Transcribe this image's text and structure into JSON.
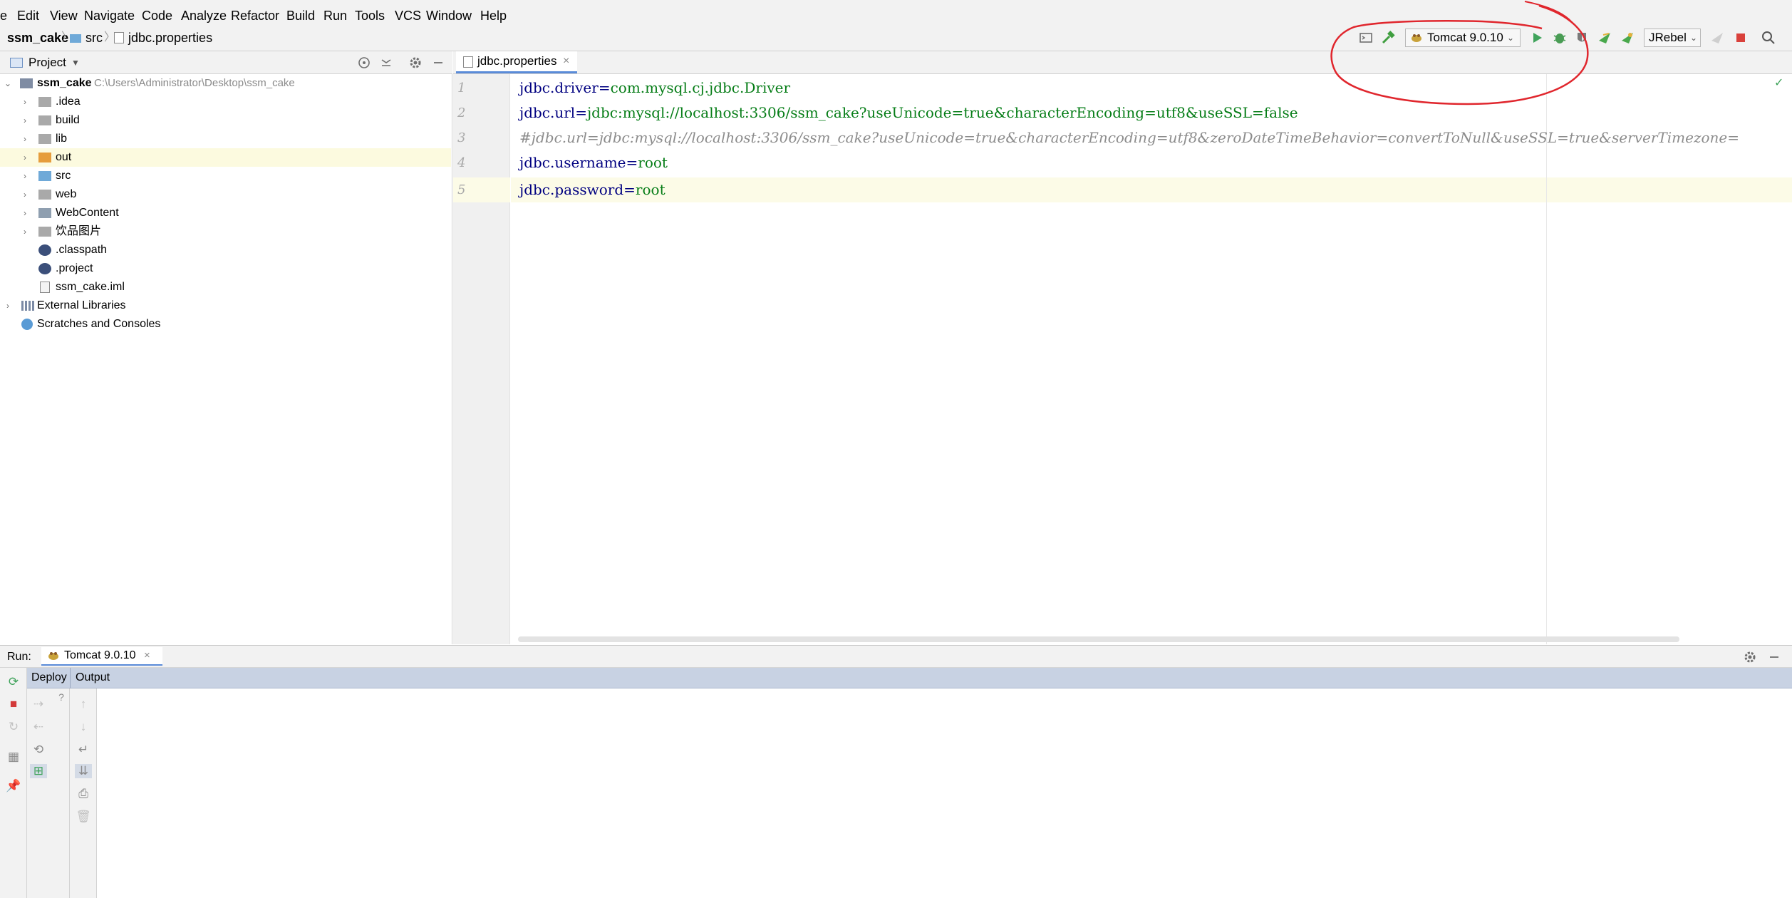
{
  "menu": {
    "items": [
      "e",
      "Edit",
      "View",
      "Navigate",
      "Code",
      "Analyze",
      "Refactor",
      "Build",
      "Run",
      "Tools",
      "VCS",
      "Window",
      "Help"
    ]
  },
  "breadcrumb": {
    "project": "ssm_cake",
    "folder": "src",
    "file": "jdbc.properties"
  },
  "toolbar": {
    "run_config": "Tomcat 9.0.10",
    "jrebel_label": "JRebel"
  },
  "project_panel": {
    "title": "Project",
    "root_name": "ssm_cake",
    "root_path": "C:\\Users\\Administrator\\Desktop\\ssm_cake",
    "items": [
      {
        "label": ".idea"
      },
      {
        "label": "build"
      },
      {
        "label": "lib"
      },
      {
        "label": "out"
      },
      {
        "label": "src"
      },
      {
        "label": "web"
      },
      {
        "label": "WebContent"
      },
      {
        "label": "饮品图片"
      },
      {
        "label": ".classpath"
      },
      {
        "label": ".project"
      },
      {
        "label": "ssm_cake.iml"
      }
    ],
    "external_libraries": "External Libraries",
    "scratches": "Scratches and Consoles"
  },
  "editor": {
    "tab_label": "jdbc.properties",
    "tab_close": "×",
    "line_numbers": [
      "1",
      "2",
      "3",
      "4",
      "5"
    ],
    "lines": [
      {
        "key": "jdbc.driver",
        "eq": "=",
        "value": "com.mysql.cj.jdbc.Driver"
      },
      {
        "key": "jdbc.url",
        "eq": "=",
        "value": "jdbc:mysql://localhost:3306/ssm_cake?useUnicode=true&characterEncoding=utf8&useSSL=false"
      },
      {
        "comment": "#jdbc.url=jdbc:mysql://localhost:3306/ssm_cake?useUnicode=true&characterEncoding=utf8&zeroDateTimeBehavior=convertToNull&useSSL=true&serverTimezone="
      },
      {
        "key": "jdbc.username",
        "eq": "=",
        "value": "root"
      },
      {
        "key": "jdbc.password",
        "eq": "=",
        "value": "root"
      }
    ]
  },
  "run_panel": {
    "label": "Run:",
    "tab_label": "Tomcat 9.0.10",
    "tab_close": "×",
    "deploy_label": "Deploy",
    "output_label": "Output"
  },
  "colors": {
    "accent_tab": "#5a8bd8",
    "annotation": "#e0262d",
    "property_key": "#000080",
    "property_value": "#067d17",
    "comment": "#8c8c8c"
  }
}
